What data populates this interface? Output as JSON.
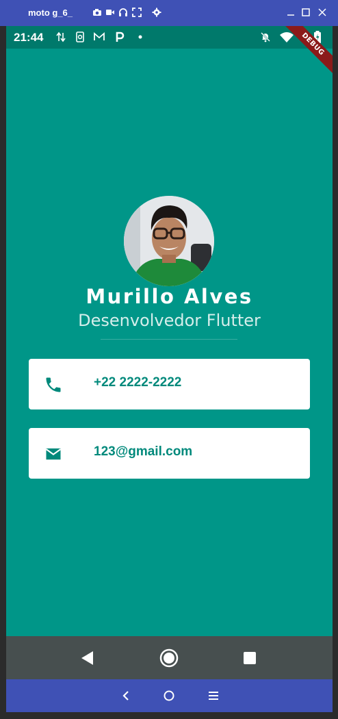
{
  "emulator": {
    "title": "moto g_6_",
    "icons": [
      "camera-icon",
      "video-icon",
      "headset-icon",
      "fullscreen-icon",
      "settings-icon"
    ],
    "window_buttons": [
      "minimize-icon",
      "maximize-icon",
      "close-icon"
    ],
    "nav_icons": [
      "back-chevron-icon",
      "home-circle-icon",
      "menu-icon"
    ],
    "bar_color": "#3f51b5"
  },
  "status_bar": {
    "time": "21:44",
    "icons": [
      "data-transfer-icon",
      "phone-sync-icon",
      "gmail-icon",
      "p-icon",
      "dot-icon",
      "notifications-off-icon",
      "wifi-icon",
      "battery-icon"
    ]
  },
  "debug_banner": "DEBUG",
  "profile": {
    "name": "Murillo Alves",
    "role": "Desenvolvedor Flutter",
    "avatar_icon": "profile-photo"
  },
  "contacts": [
    {
      "icon": "phone-icon",
      "text": "+22 2222-2222"
    },
    {
      "icon": "email-icon",
      "text": "123@gmail.com"
    }
  ],
  "nav_bar": {
    "icons": [
      "back-triangle-icon",
      "home-icon",
      "recents-icon"
    ]
  },
  "colors": {
    "background": "#009688",
    "status_bar": "#00796b",
    "card_text": "#00897b",
    "nav_bar": "#474f4f"
  }
}
